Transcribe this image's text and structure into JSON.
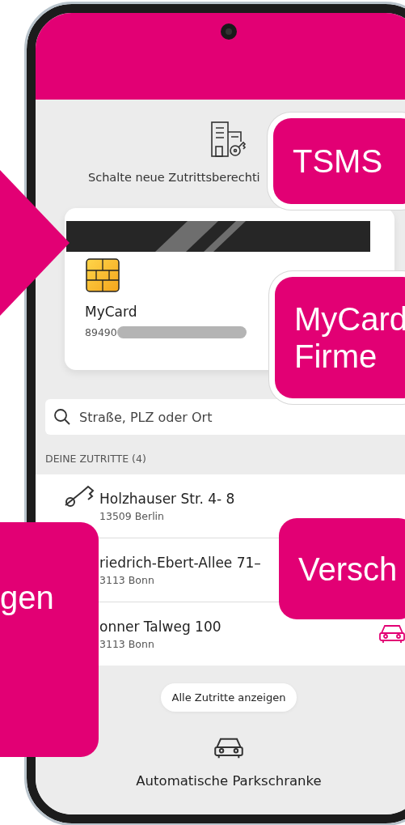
{
  "access_prompt": {
    "label": "Schalte neue Zutrittsberechti"
  },
  "card": {
    "name": "MyCard",
    "number": "89490"
  },
  "search": {
    "placeholder": "Straße, PLZ oder Ort"
  },
  "section_title": "DEINE ZUTRITTE (4)",
  "accesses": [
    {
      "kind": "key",
      "street": "Holzhauser Str. 4- 8",
      "city": "13509 Berlin"
    },
    {
      "kind": "none",
      "street": "riedrich-Ebert-Allee 71–",
      "city": "3113 Bonn"
    },
    {
      "kind": "car",
      "street": "onner Talweg 100",
      "city": "3113 Bonn"
    }
  ],
  "show_all_button": "Alle Zutritte anzeigen",
  "parking": {
    "label": "Automatische Parkschranke"
  },
  "callouts": [
    {
      "kind": "arrow"
    },
    {
      "kind": "box",
      "ring": true,
      "lines": [
        "TSMS"
      ]
    },
    {
      "kind": "box",
      "ring": true,
      "lines": [
        "MyCard",
        "Firme"
      ]
    },
    {
      "kind": "box",
      "ring": false,
      "lines": [
        "Versch"
      ]
    },
    {
      "kind": "box",
      "ring": false,
      "lines": [
        "gen"
      ]
    }
  ]
}
